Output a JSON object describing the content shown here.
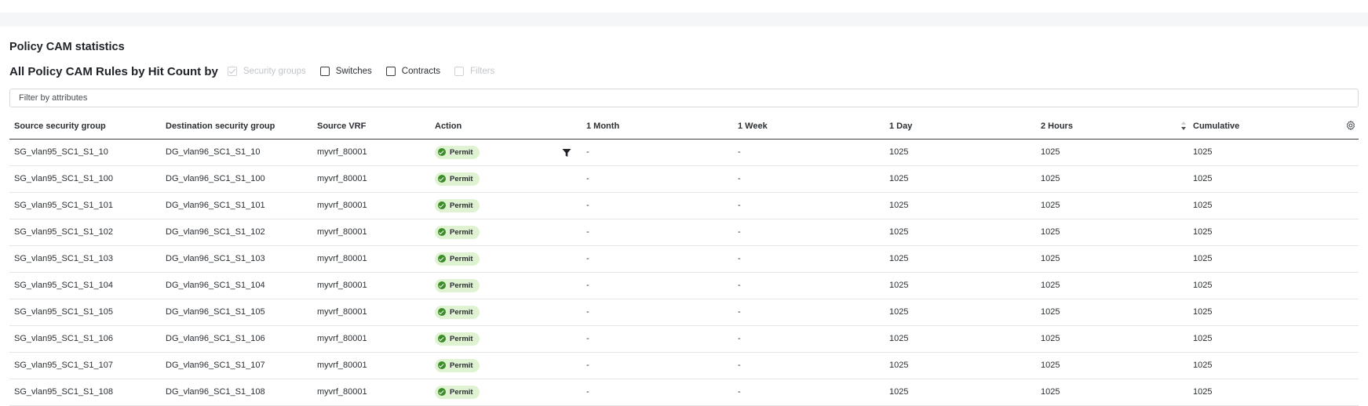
{
  "section_title": "Policy CAM statistics",
  "group_by": {
    "label": "All Policy CAM Rules by Hit Count by",
    "options": [
      {
        "label": "Security groups",
        "checked": true,
        "disabled": true
      },
      {
        "label": "Switches",
        "checked": false,
        "disabled": false
      },
      {
        "label": "Contracts",
        "checked": false,
        "disabled": false
      },
      {
        "label": "Filters",
        "checked": false,
        "disabled": true
      }
    ]
  },
  "filter": {
    "placeholder": "Filter by attributes",
    "value": ""
  },
  "table": {
    "columns": [
      {
        "key": "source_sg",
        "label": "Source security group"
      },
      {
        "key": "dest_sg",
        "label": "Destination security group"
      },
      {
        "key": "source_vrf",
        "label": "Source VRF"
      },
      {
        "key": "action",
        "label": "Action"
      },
      {
        "key": "month",
        "label": "1 Month"
      },
      {
        "key": "week",
        "label": "1 Week"
      },
      {
        "key": "day",
        "label": "1 Day"
      },
      {
        "key": "hours2",
        "label": "2 Hours"
      },
      {
        "key": "cumulative",
        "label": "Cumulative"
      }
    ],
    "sorted_column": "2 Hours",
    "sort_direction": "descending",
    "rows": [
      {
        "source_sg": "SG_vlan95_SC1_S1_10",
        "dest_sg": "DG_vlan96_SC1_S1_10",
        "source_vrf": "myvrf_80001",
        "action": "Permit",
        "month": "-",
        "week": "-",
        "day": "1025",
        "hours2": "1025",
        "cumulative": "1025"
      },
      {
        "source_sg": "SG_vlan95_SC1_S1_100",
        "dest_sg": "DG_vlan96_SC1_S1_100",
        "source_vrf": "myvrf_80001",
        "action": "Permit",
        "month": "-",
        "week": "-",
        "day": "1025",
        "hours2": "1025",
        "cumulative": "1025"
      },
      {
        "source_sg": "SG_vlan95_SC1_S1_101",
        "dest_sg": "DG_vlan96_SC1_S1_101",
        "source_vrf": "myvrf_80001",
        "action": "Permit",
        "month": "-",
        "week": "-",
        "day": "1025",
        "hours2": "1025",
        "cumulative": "1025"
      },
      {
        "source_sg": "SG_vlan95_SC1_S1_102",
        "dest_sg": "DG_vlan96_SC1_S1_102",
        "source_vrf": "myvrf_80001",
        "action": "Permit",
        "month": "-",
        "week": "-",
        "day": "1025",
        "hours2": "1025",
        "cumulative": "1025"
      },
      {
        "source_sg": "SG_vlan95_SC1_S1_103",
        "dest_sg": "DG_vlan96_SC1_S1_103",
        "source_vrf": "myvrf_80001",
        "action": "Permit",
        "month": "-",
        "week": "-",
        "day": "1025",
        "hours2": "1025",
        "cumulative": "1025"
      },
      {
        "source_sg": "SG_vlan95_SC1_S1_104",
        "dest_sg": "DG_vlan96_SC1_S1_104",
        "source_vrf": "myvrf_80001",
        "action": "Permit",
        "month": "-",
        "week": "-",
        "day": "1025",
        "hours2": "1025",
        "cumulative": "1025"
      },
      {
        "source_sg": "SG_vlan95_SC1_S1_105",
        "dest_sg": "DG_vlan96_SC1_S1_105",
        "source_vrf": "myvrf_80001",
        "action": "Permit",
        "month": "-",
        "week": "-",
        "day": "1025",
        "hours2": "1025",
        "cumulative": "1025"
      },
      {
        "source_sg": "SG_vlan95_SC1_S1_106",
        "dest_sg": "DG_vlan96_SC1_S1_106",
        "source_vrf": "myvrf_80001",
        "action": "Permit",
        "month": "-",
        "week": "-",
        "day": "1025",
        "hours2": "1025",
        "cumulative": "1025"
      },
      {
        "source_sg": "SG_vlan95_SC1_S1_107",
        "dest_sg": "DG_vlan96_SC1_S1_107",
        "source_vrf": "myvrf_80001",
        "action": "Permit",
        "month": "-",
        "week": "-",
        "day": "1025",
        "hours2": "1025",
        "cumulative": "1025"
      },
      {
        "source_sg": "SG_vlan95_SC1_S1_108",
        "dest_sg": "DG_vlan96_SC1_S1_108",
        "source_vrf": "myvrf_80001",
        "action": "Permit",
        "month": "-",
        "week": "-",
        "day": "1025",
        "hours2": "1025",
        "cumulative": "1025"
      }
    ]
  },
  "icons": {
    "settings": "gear-icon",
    "column_filter": "funnel-icon",
    "sort": "sort-desc-icon",
    "permit": "check-circle-icon"
  },
  "colors": {
    "permit_bg": "#dff3d2",
    "permit_icon": "#3c8c2a",
    "header_rule": "#3a3f44"
  }
}
